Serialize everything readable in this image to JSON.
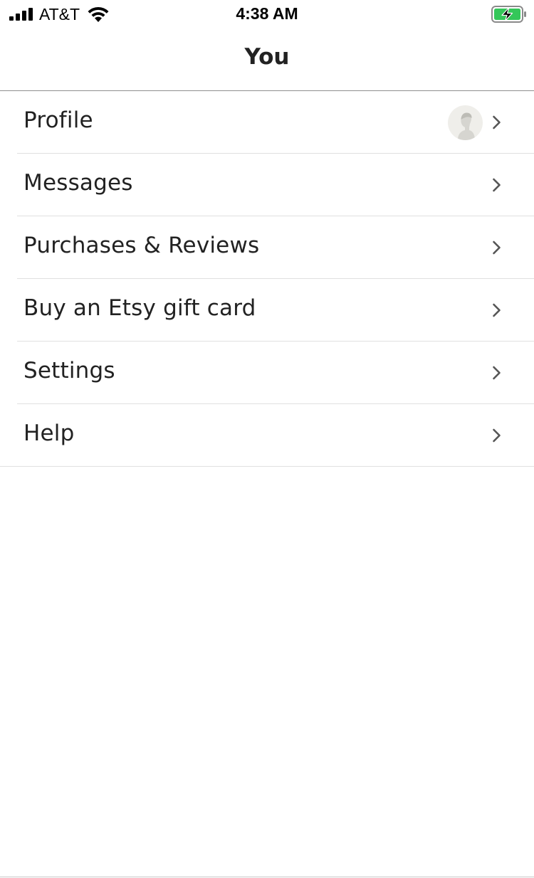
{
  "status_bar": {
    "carrier": "AT&T",
    "time": "4:38 AM",
    "battery_color": "#34c759"
  },
  "nav": {
    "title": "You"
  },
  "menu": {
    "items": [
      {
        "label": "Profile",
        "icon": "chevron-right-icon",
        "has_avatar": true
      },
      {
        "label": "Messages",
        "icon": "chevron-right-icon"
      },
      {
        "label": "Purchases & Reviews",
        "icon": "chevron-right-icon"
      },
      {
        "label": "Buy an Etsy gift card",
        "icon": "chevron-right-icon"
      },
      {
        "label": "Settings",
        "icon": "chevron-right-icon"
      },
      {
        "label": "Help",
        "icon": "chevron-right-icon"
      }
    ]
  }
}
